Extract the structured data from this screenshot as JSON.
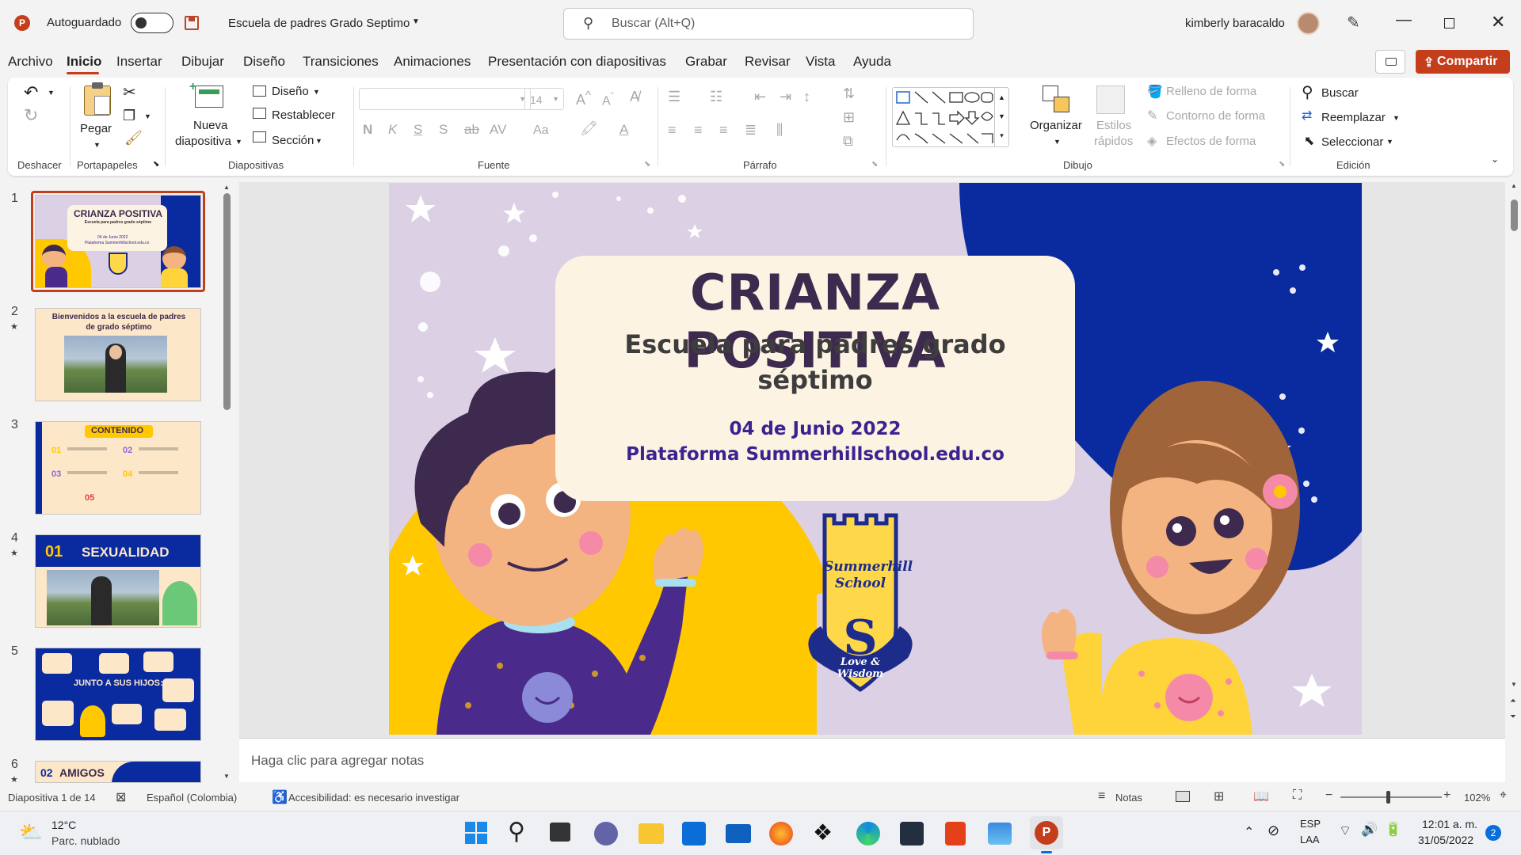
{
  "titlebar": {
    "autosave_label": "Autoguardado",
    "doc_title": "Escuela de padres Grado Septimo",
    "search_placeholder": "Buscar (Alt+Q)",
    "user_name": "kimberly baracaldo"
  },
  "menu": {
    "items": [
      "Archivo",
      "Inicio",
      "Insertar",
      "Dibujar",
      "Diseño",
      "Transiciones",
      "Animaciones",
      "Presentación con diapositivas",
      "Grabar",
      "Revisar",
      "Vista",
      "Ayuda"
    ],
    "active": "Inicio",
    "share_label": "Compartir"
  },
  "ribbon": {
    "groups": {
      "undo": "Deshacer",
      "clipboard": "Portapapeles",
      "slides": "Diapositivas",
      "font": "Fuente",
      "paragraph": "Párrafo",
      "drawing": "Dibujo",
      "editing": "Edición"
    },
    "paste_label": "Pegar",
    "new_slide_label1": "Nueva",
    "new_slide_label2": "diapositiva",
    "layout_label": "Diseño",
    "reset_label": "Restablecer",
    "section_label": "Sección",
    "font_size": "14",
    "arrange_label": "Organizar",
    "quick_styles1": "Estilos",
    "quick_styles2": "rápidos",
    "shape_fill": "Relleno de forma",
    "shape_outline": "Contorno de forma",
    "shape_effects": "Efectos de forma",
    "find_label": "Buscar",
    "replace_label": "Reemplazar",
    "select_label": "Seleccionar"
  },
  "thumbnails": [
    {
      "num": "1",
      "title": "CRIANZA POSITIVA",
      "sub": "Escuela para padres grado séptimo",
      "line1": "04 de Junio 2022",
      "line2": "Plataforma Summerhillschool.edu.co",
      "starred": false
    },
    {
      "num": "2",
      "title": "Bienvenidos a la escuela de padres de grado séptimo",
      "starred": true
    },
    {
      "num": "3",
      "title": "CONTENIDO",
      "items": [
        "01",
        "02",
        "03",
        "04",
        "05"
      ],
      "starred": false
    },
    {
      "num": "4",
      "title": "SEXUALIDAD",
      "badge": "01",
      "starred": true
    },
    {
      "num": "5",
      "title": "JUNTO A SUS HIJOS:",
      "starred": false
    },
    {
      "num": "6",
      "title": "AMIGOS",
      "badge": "02",
      "starred": true
    }
  ],
  "slide": {
    "title": "CRIANZA POSITIVA",
    "subtitle_line1": "Escuela para padres grado",
    "subtitle_line2": "séptimo",
    "date": "04 de Junio 2022",
    "platform": "Plataforma Summerhillschool.edu.co",
    "logo_line1": "Summerhill",
    "logo_line2": "School",
    "logo_motto": "Love & Wisdom"
  },
  "notes_placeholder": "Haga clic para agregar notas",
  "status": {
    "slide_pos": "Diapositiva 1 de 14",
    "language": "Español (Colombia)",
    "accessibility": "Accesibilidad: es necesario investigar",
    "notes_label": "Notas",
    "zoom": "102%"
  },
  "taskbar": {
    "weather_temp": "12°C",
    "weather_desc": "Parc. nublado",
    "lang1": "ESP",
    "lang2": "LAA",
    "time": "12:01 a. m.",
    "date": "31/05/2022",
    "notif_count": "2"
  },
  "colors": {
    "accent_red": "#c43e1c",
    "slide_purple": "#3d2a4e",
    "slide_navy": "#0a2aa0",
    "slide_yellow": "#ffc800",
    "slide_cream": "#fdf3e3",
    "slide_text": "#3a2391"
  }
}
